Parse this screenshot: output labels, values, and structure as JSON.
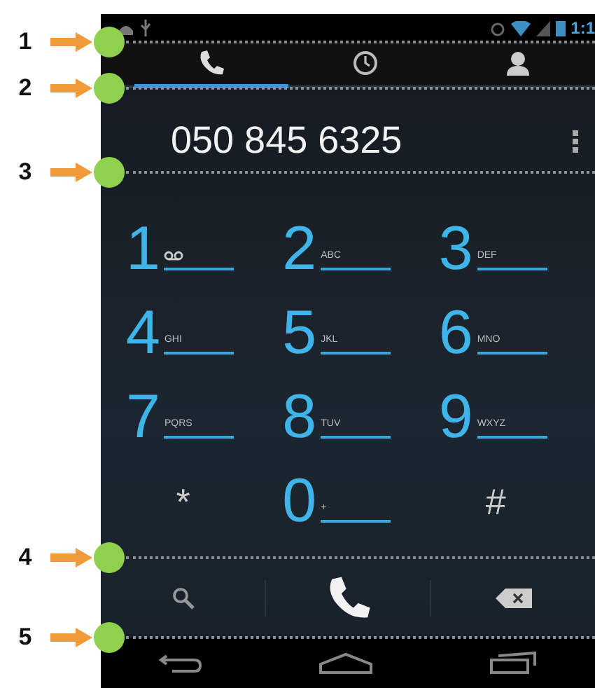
{
  "status_bar": {
    "time": "1:1"
  },
  "tabs": [
    {
      "kind": "phone",
      "selected": true
    },
    {
      "kind": "clock",
      "selected": false
    },
    {
      "kind": "person",
      "selected": false
    }
  ],
  "number_field": {
    "value": "050 845 6325"
  },
  "keypad": [
    {
      "kind": "voicemail",
      "digit": "1"
    },
    {
      "kind": "letters",
      "digit": "2",
      "letters": "ABC"
    },
    {
      "kind": "letters",
      "digit": "3",
      "letters": "DEF"
    },
    {
      "kind": "letters",
      "digit": "4",
      "letters": "GHI"
    },
    {
      "kind": "letters",
      "digit": "5",
      "letters": "JKL"
    },
    {
      "kind": "letters",
      "digit": "6",
      "letters": "MNO"
    },
    {
      "kind": "letters",
      "digit": "7",
      "letters": "PQRS"
    },
    {
      "kind": "letters",
      "digit": "8",
      "letters": "TUV"
    },
    {
      "kind": "letters",
      "digit": "9",
      "letters": "WXYZ"
    },
    {
      "kind": "symbol",
      "digit": "*"
    },
    {
      "kind": "letters",
      "digit": "0",
      "letters": "+"
    },
    {
      "kind": "symbol",
      "digit": "#"
    }
  ],
  "annotations": [
    {
      "label": "1"
    },
    {
      "label": "2"
    },
    {
      "label": "3"
    },
    {
      "label": "4"
    },
    {
      "label": "5"
    }
  ]
}
